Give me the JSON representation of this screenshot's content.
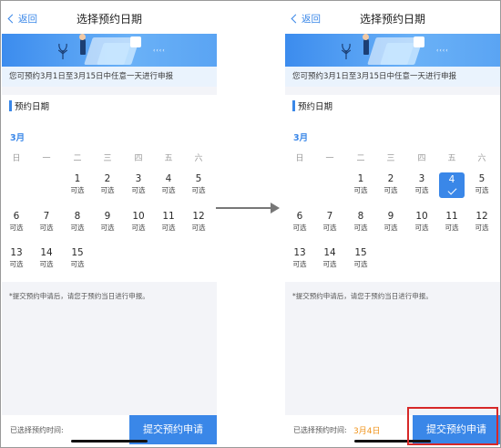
{
  "nav": {
    "back_label": "返回",
    "title": "选择预约日期"
  },
  "notice": "您可预约3月1日至3月15日中任意一天进行申报",
  "section_title": "预约日期",
  "calendar": {
    "month": "3月",
    "weekdays": [
      "日",
      "一",
      "二",
      "三",
      "四",
      "五",
      "六"
    ],
    "days": [
      {
        "n": "1",
        "s": "可选"
      },
      {
        "n": "2",
        "s": "可选"
      },
      {
        "n": "3",
        "s": "可选"
      },
      {
        "n": "4",
        "s": "可选"
      },
      {
        "n": "5",
        "s": "可选"
      },
      {
        "n": "6",
        "s": "可选"
      },
      {
        "n": "7",
        "s": "可选"
      },
      {
        "n": "8",
        "s": "可选"
      },
      {
        "n": "9",
        "s": "可选"
      },
      {
        "n": "10",
        "s": "可选"
      },
      {
        "n": "11",
        "s": "可选"
      },
      {
        "n": "12",
        "s": "可选"
      },
      {
        "n": "13",
        "s": "可选"
      },
      {
        "n": "14",
        "s": "可选"
      },
      {
        "n": "15",
        "s": "可选"
      }
    ],
    "first_weekday": 2,
    "selected_day_right": "4"
  },
  "footnote": "*提交预约申请后，请您于预约当日进行申报。",
  "bottom": {
    "label": "已选择预约时间:",
    "selected_value_right": "3月4日",
    "submit_label": "提交预约申请"
  },
  "colors": {
    "accent": "#3a87e8",
    "selected_text": "#f0941c",
    "highlight": "#d62828"
  }
}
